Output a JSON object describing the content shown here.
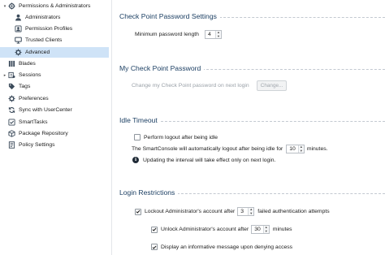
{
  "sidebar": {
    "items": [
      {
        "label": "Permissions & Administrators",
        "expanded": true,
        "icon": "permissions-icon"
      },
      {
        "label": "Administrators",
        "icon": "user-icon"
      },
      {
        "label": "Permission Profiles",
        "icon": "profile-icon"
      },
      {
        "label": "Trusted Clients",
        "icon": "monitor-icon"
      },
      {
        "label": "Advanced",
        "icon": "gear-icon",
        "selected": true
      },
      {
        "label": "Blades",
        "icon": "blades-icon"
      },
      {
        "label": "Sessions",
        "icon": "sessions-icon"
      },
      {
        "label": "Tags",
        "icon": "tag-icon"
      },
      {
        "label": "Preferences",
        "icon": "gear-icon"
      },
      {
        "label": "Sync with UserCenter",
        "icon": "sync-icon"
      },
      {
        "label": "SmartTasks",
        "icon": "tasks-icon"
      },
      {
        "label": "Package Repository",
        "icon": "package-icon"
      },
      {
        "label": "Policy Settings",
        "icon": "policy-icon"
      }
    ]
  },
  "password_settings": {
    "title": "Check Point Password Settings",
    "min_length_label": "Minimum password length",
    "min_length_value": "4"
  },
  "my_password": {
    "title": "My Check Point Password",
    "change_label": "Change my Check Point password on next login",
    "change_button": "Change..."
  },
  "idle_timeout": {
    "title": "Idle Timeout",
    "perform_logout_label": "Perform logout after being idle",
    "perform_logout_checked": false,
    "auto_logout_prefix": "The SmartConsole will automatically logout after being idle for",
    "auto_logout_value": "10",
    "auto_logout_suffix": "minutes.",
    "info_text": "Updating the interval will take effect only on next login."
  },
  "login_restrictions": {
    "title": "Login Restrictions",
    "lockout_prefix": "Lockout Administrator's account after",
    "lockout_value": "3",
    "lockout_suffix": "failed authentication attempts",
    "lockout_checked": true,
    "unlock_prefix": "Unlock Administrator's account after",
    "unlock_value": "30",
    "unlock_suffix": "minutes",
    "unlock_checked": true,
    "display_msg_label": "Display an informative message upon denying access",
    "display_msg_checked": true
  },
  "colors": {
    "section_title": "#1c3f63",
    "selected_bg": "#cfe3f7",
    "checkmark": "#1a1a1a"
  }
}
